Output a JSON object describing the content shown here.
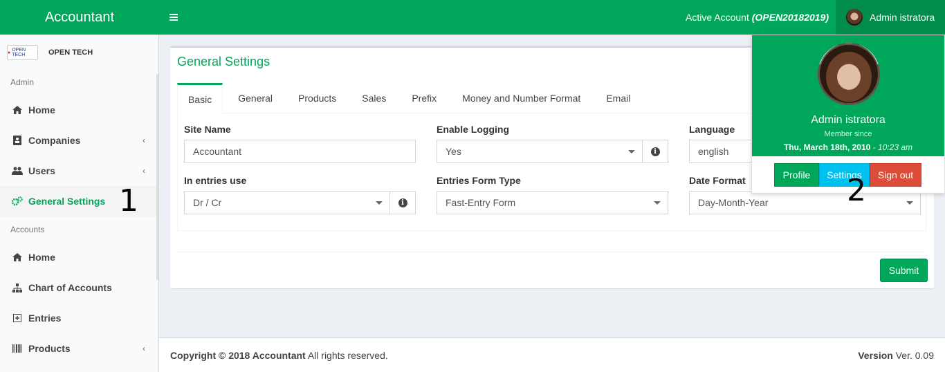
{
  "app": {
    "title": "Accountant"
  },
  "header": {
    "active_account_label": "Active Account",
    "active_account_code": "(OPEN20182019)",
    "user_name": "Admin istratora"
  },
  "sidebar": {
    "company_name": "OPEN TECH",
    "company_logo_text": "OPEN TECH",
    "sections": [
      {
        "label": "Admin"
      },
      {
        "label": "Accounts"
      }
    ],
    "items": [
      {
        "label": "Home",
        "icon": "home-icon"
      },
      {
        "label": "Companies",
        "icon": "building-icon"
      },
      {
        "label": "Users",
        "icon": "users-icon"
      },
      {
        "label": "General Settings",
        "icon": "gears-icon",
        "active": true
      },
      {
        "label": "Home",
        "icon": "home-icon"
      },
      {
        "label": "Chart of Accounts",
        "icon": "sitemap-icon"
      },
      {
        "label": "Entries",
        "icon": "plus-square-icon"
      },
      {
        "label": "Products",
        "icon": "barcode-icon"
      }
    ],
    "annotation_1": "1"
  },
  "settings": {
    "title": "General Settings",
    "tabs": [
      {
        "label": "Basic",
        "active": true
      },
      {
        "label": "General"
      },
      {
        "label": "Products"
      },
      {
        "label": "Sales"
      },
      {
        "label": "Prefix"
      },
      {
        "label": "Money and Number Format"
      },
      {
        "label": "Email"
      }
    ],
    "fields": {
      "site_name": {
        "label": "Site Name",
        "value": "Accountant"
      },
      "enable_logging": {
        "label": "Enable Logging",
        "value": "Yes"
      },
      "language": {
        "label": "Language",
        "value": "english"
      },
      "entries_use": {
        "label": "In entries use",
        "value": "Dr / Cr"
      },
      "entries_form_type": {
        "label": "Entries Form Type",
        "value": "Fast-Entry Form"
      },
      "date_format": {
        "label": "Date Format",
        "value": "Day-Month-Year"
      }
    },
    "submit_label": "Submit"
  },
  "user_dropdown": {
    "name": "Admin istratora",
    "member_since_label": "Member since",
    "member_date": "Thu, March 18th, 2010",
    "member_time": "- 10:23 am",
    "profile_label": "Profile",
    "settings_label": "Settings",
    "signout_label": "Sign out",
    "annotation_2": "2"
  },
  "footer": {
    "copyright_bold": "Copyright © 2018 Accountant",
    "copyright_rest": " All rights reserved.",
    "version_label": "Version",
    "version_value": " Ver. 0.09"
  },
  "colors": {
    "brand": "#00a65a",
    "brand_dark": "#008d4c",
    "info": "#00c0ef",
    "danger": "#dd4b39"
  }
}
